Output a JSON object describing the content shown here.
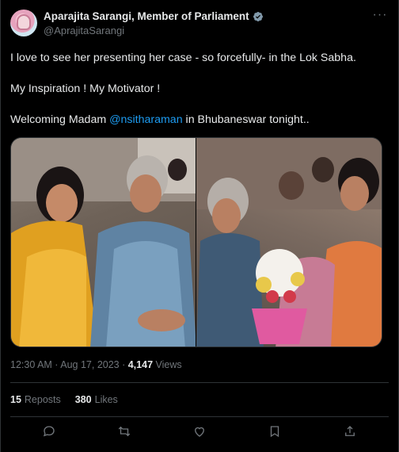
{
  "author": {
    "display_name": "Aparajita Sarangi, Member of Parliament",
    "handle": "@AprajitaSarangi",
    "verified": true
  },
  "tweet": {
    "line1": "I love to see her presenting her case - so forcefully- in the Lok Sabha.",
    "line2": "My Inspiration ! My Motivator !",
    "line3_prefix": "Welcoming Madam ",
    "line3_mention": "@nsitharaman",
    "line3_suffix": " in Bhubaneswar tonight.."
  },
  "meta": {
    "time": "12:30 AM",
    "sep1": " · ",
    "date": "Aug 17, 2023",
    "sep2": " · ",
    "views_count": "4,147",
    "views_label": " Views"
  },
  "stats": {
    "reposts_count": "15",
    "reposts_label": "Reposts",
    "likes_count": "380",
    "likes_label": "Likes"
  },
  "icons": {
    "more": "more-icon",
    "reply": "reply-icon",
    "repost": "repost-icon",
    "like": "like-icon",
    "bookmark": "bookmark-icon",
    "share": "share-icon",
    "verified": "verified-badge-icon"
  },
  "colors": {
    "background": "#000000",
    "text": "#e7e9ea",
    "muted": "#71767b",
    "link": "#1d9bf0",
    "border": "#2f3336",
    "verified": "#829aab"
  }
}
